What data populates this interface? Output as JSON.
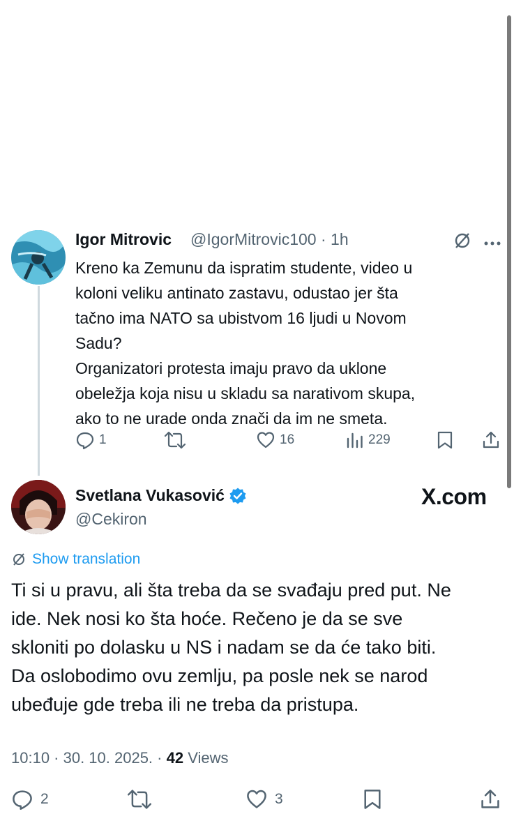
{
  "reply": {
    "author_name": "Igor Mitrovic",
    "handle": "@IgorMitrovic100",
    "time": "1h",
    "text_lines": [
      "Kreno ka Zemunu da ispratim studente, video u",
      "koloni veliku antinato zastavu, odustao jer šta",
      "tačno ima NATO sa ubistvom 16 ljudi u Novom",
      "Sadu?",
      "Organizatori protesta imaju pravo da uklone",
      "obeležja koja nisu u skladu sa narativom skupa,",
      "ako to ne urade onda znači da im ne smeta."
    ],
    "replies_count": "1",
    "likes_count": "16",
    "views_count": "229"
  },
  "main": {
    "author_name": "Svetlana Vukasović",
    "handle": "@Cekiron",
    "watermark": "X.com",
    "translation_label": "Show translation",
    "text_lines": [
      "Ti si u pravu, ali šta treba da se svađaju pred put. Ne",
      "ide. Nek nosi ko šta hoće. Rečeno je da se sve",
      "skloniti po dolasku u NS i nadam se da će tako biti.",
      "Da oslobodimo ovu zemlju, pa posle nek se narod",
      "ubeđuje gde treba ili ne treba da pristupa."
    ],
    "timestamp": "10:10 · 30. 10. 2025. ·",
    "views_count": "42",
    "views_label": "Views",
    "replies_count": "2",
    "likes_count": "3"
  },
  "colors": {
    "accent": "#1d9bf0",
    "muted": "#536471",
    "text": "#0f1419",
    "thread_line": "#cfd9de"
  },
  "icons": [
    "translate-icon",
    "more-icon",
    "reply-icon",
    "retweet-icon",
    "like-icon",
    "views-icon",
    "bookmark-icon",
    "share-icon",
    "verified-badge-icon"
  ]
}
